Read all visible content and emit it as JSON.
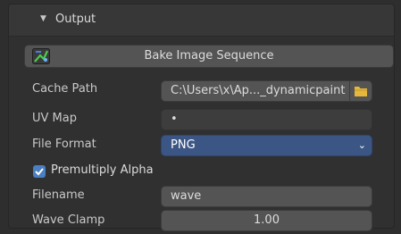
{
  "panel": {
    "title": "Output",
    "expanded": true
  },
  "bake_button": {
    "label": "Bake Image Sequence",
    "icon": "bake-icon"
  },
  "cache_path": {
    "label": "Cache Path",
    "value": "C:\\Users\\x\\Ap..._dynamicpaint",
    "folder_icon": "folder-icon"
  },
  "uv_map": {
    "label": "UV Map",
    "value": "•"
  },
  "file_format": {
    "label": "File Format",
    "value": "PNG"
  },
  "premultiply_alpha": {
    "label": "Premultiply Alpha",
    "checked": true
  },
  "filename": {
    "label": "Filename",
    "value": "wave"
  },
  "wave_clamp": {
    "label": "Wave Clamp",
    "value": "1.00"
  },
  "colors": {
    "accent_blue": "#3b5685",
    "checkbox_blue": "#4a7fc1",
    "folder_yellow": "#e5b73b",
    "icon_green": "#4ec84e"
  }
}
